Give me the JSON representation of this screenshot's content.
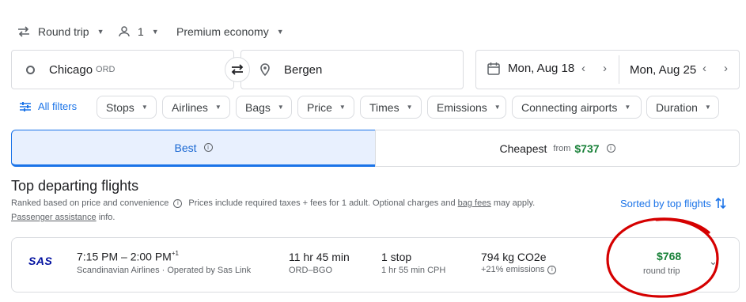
{
  "search": {
    "trip_type": "Round trip",
    "passengers": "1",
    "cabin_class": "Premium economy",
    "origin": "Chicago",
    "origin_code": "ORD",
    "destination": "Bergen",
    "depart_date": "Mon, Aug 18",
    "return_date": "Mon, Aug 25"
  },
  "filters": {
    "all_filters": "All filters",
    "chips": [
      "Stops",
      "Airlines",
      "Bags",
      "Price",
      "Times",
      "Emissions",
      "Connecting airports",
      "Duration"
    ]
  },
  "tabs": {
    "best": "Best",
    "cheapest": "Cheapest",
    "cheapest_from": "from",
    "cheapest_price": "$737"
  },
  "section": {
    "title": "Top departing flights",
    "ranked_text": "Ranked based on price and convenience",
    "prices_text_1": "Prices include required taxes + fees for 1 adult. Optional charges and",
    "bag_fees_link": "bag fees",
    "prices_text_2": "may apply.",
    "passenger_assistance_link": "Passenger assistance",
    "info_suffix": "info.",
    "sort_label": "Sorted by top flights"
  },
  "flight": {
    "airline_logo": "SAS",
    "times": "7:15 PM – 2:00 PM",
    "plus_days": "+1",
    "airline": "Scandinavian Airlines · Operated by Sas Link",
    "duration": "11 hr 45 min",
    "route": "ORD–BGO",
    "stops": "1 stop",
    "layover": "1 hr 55 min CPH",
    "emissions": "794 kg CO2e",
    "emissions_delta": "+21% emissions",
    "price": "$768",
    "price_type": "round trip"
  },
  "colors": {
    "accent_blue": "#1a73e8",
    "price_green": "#188038",
    "annotation_red": "#d50000",
    "sas_blue": "#000f9f"
  }
}
